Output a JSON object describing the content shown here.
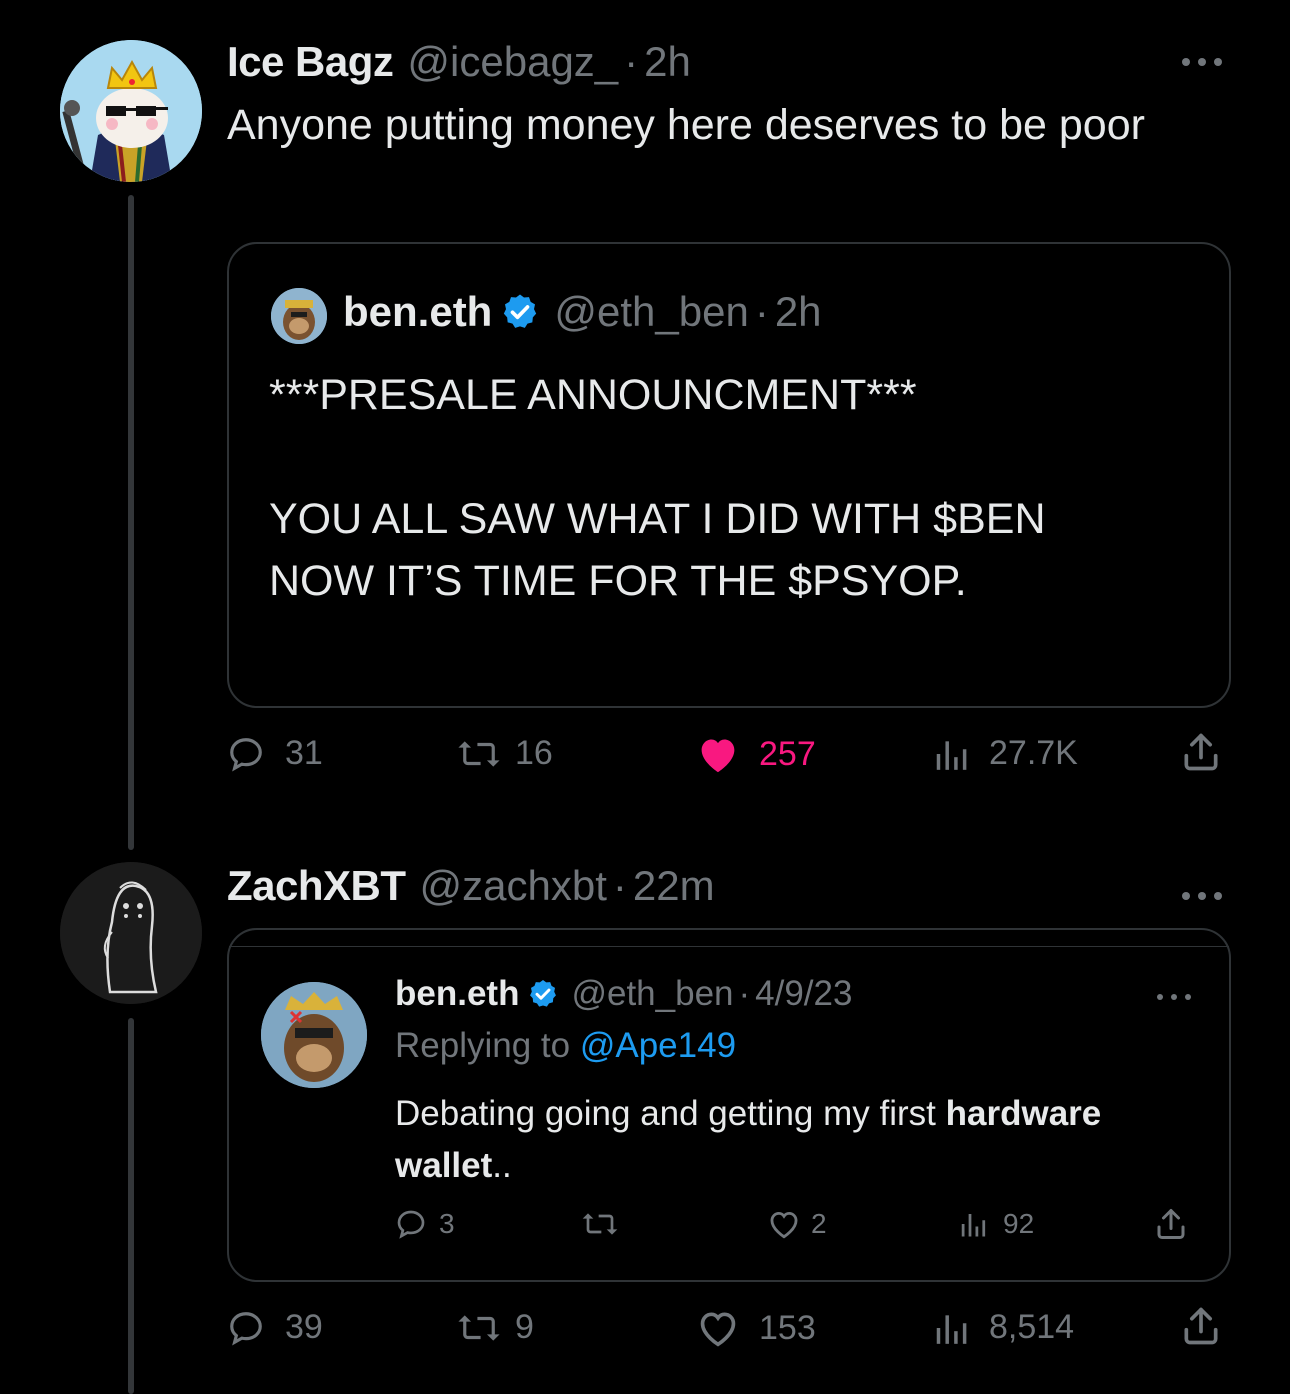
{
  "tweet1": {
    "name": "Ice Bagz",
    "handle": "@icebagz_",
    "dot": "·",
    "time": "2h",
    "text": "Anyone putting money here deserves to be poor",
    "quote": {
      "name": "ben.eth",
      "handle": "@eth_ben",
      "dot": "·",
      "time": "2h",
      "line1": "***PRESALE ANNOUNCMENT***",
      "line2": "YOU ALL SAW WHAT I DID WITH $BEN",
      "line3": "NOW IT’S TIME FOR THE $PSYOP."
    },
    "actions": {
      "replies": "31",
      "retweets": "16",
      "likes": "257",
      "views": "27.7K"
    },
    "like_color": "#f91880"
  },
  "tweet2": {
    "name": "ZachXBT",
    "handle": "@zachxbt",
    "dot": "·",
    "time": "22m",
    "embedded": {
      "name": "ben.eth",
      "handle": "@eth_ben",
      "dot": "·",
      "date": "4/9/23",
      "replying_prefix": "Replying to",
      "replying_handle": "@Ape149",
      "text_before": "Debating going and getting my first",
      "text_bold1": "hardware",
      "text_bold2": "wallet",
      "text_after": "..",
      "actions": {
        "replies": "3",
        "likes": "2",
        "views": "92"
      }
    },
    "actions": {
      "replies": "39",
      "retweets": "9",
      "likes": "153",
      "views": "8,514"
    }
  },
  "colors": {
    "background": "#000000",
    "text_primary": "#e7e9ea",
    "text_secondary": "#71767b",
    "verified": "#1d9bf0",
    "link": "#1d9bf0",
    "like": "#f91880"
  }
}
